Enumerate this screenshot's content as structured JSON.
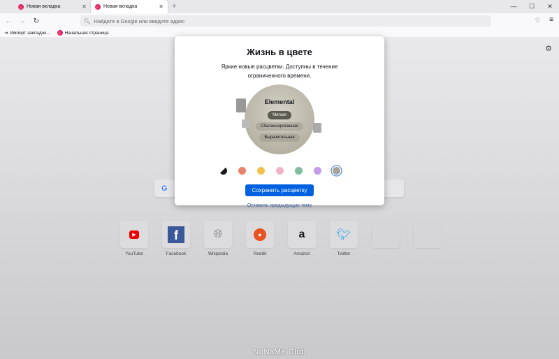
{
  "tabs": [
    {
      "label": "Новая вкладка"
    },
    {
      "label": "Новая вкладка"
    }
  ],
  "toolbar": {
    "url_placeholder": "Найдите в Google или введите адрес"
  },
  "bookmarks": [
    {
      "label": "Импорт закладок..."
    },
    {
      "label": "Начальная страница"
    }
  ],
  "modal": {
    "title": "Жизнь в цвете",
    "subtitle": "Яркие новые расцветки. Доступны в течение ограниченного времени.",
    "theme_name": "Elemental",
    "intensities": [
      "Мягкая",
      "Сбалансированная",
      "Выразительная"
    ],
    "colors": [
      "#1a1a1a",
      "#e8826a",
      "#f3c24c",
      "#f1b3c8",
      "#7fbf9d",
      "#c39be8",
      "#a8a39a"
    ],
    "save_label": "Сохранить расцветку",
    "keep_label": "Оставить предыдущую тему"
  },
  "shortcuts": [
    {
      "label": "YouTube"
    },
    {
      "label": "Facebook"
    },
    {
      "label": "Wikipedia"
    },
    {
      "label": "Reddit"
    },
    {
      "label": "Amazon"
    },
    {
      "label": "Twitter"
    }
  ],
  "watermark": "NoNaMe-Club"
}
